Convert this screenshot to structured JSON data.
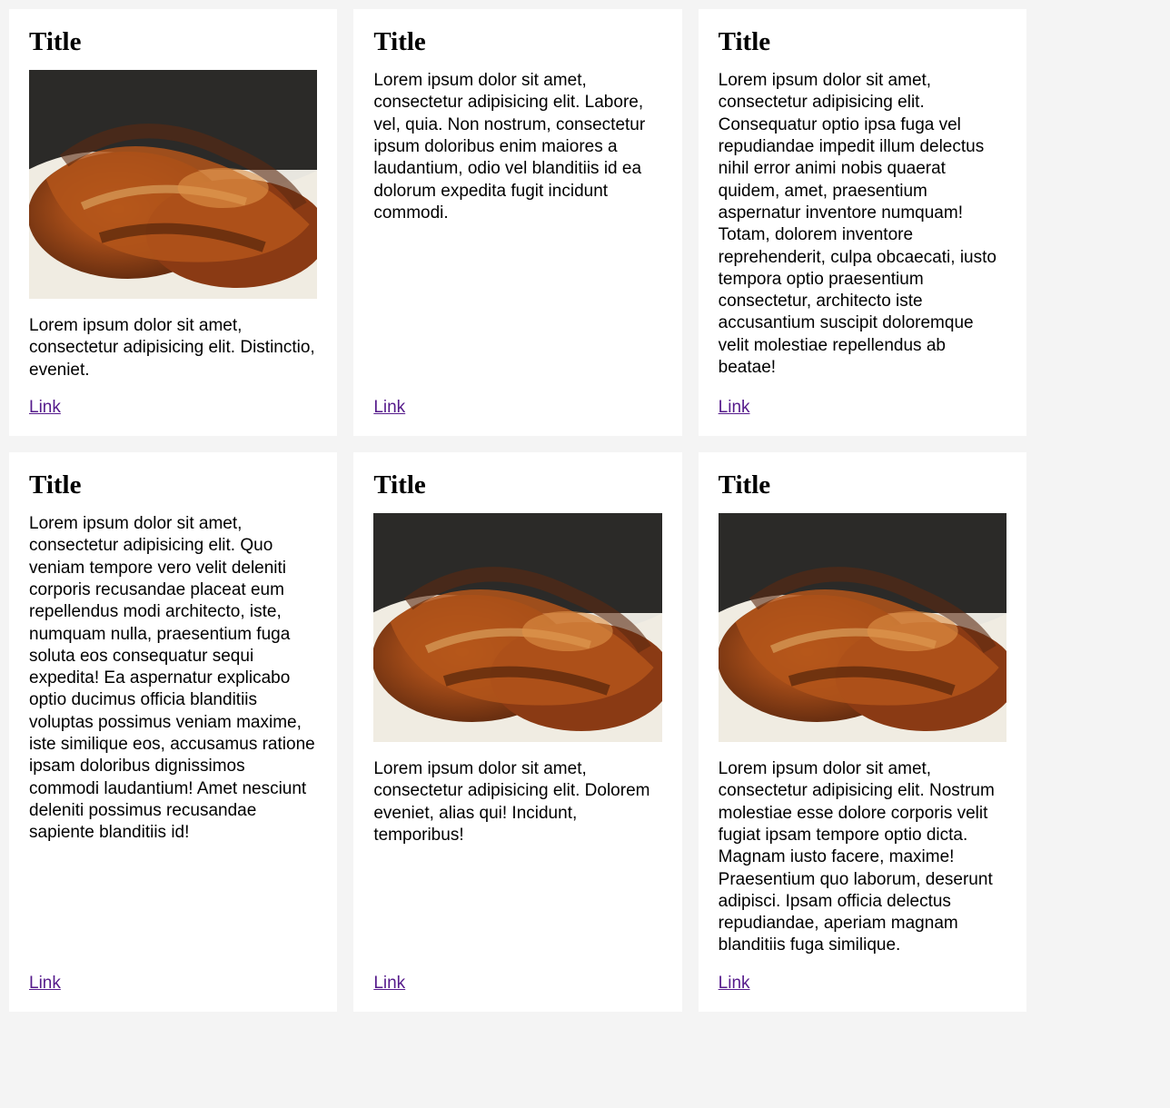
{
  "cards": [
    {
      "title": "Title",
      "hasImage": true,
      "text": "Lorem ipsum dolor sit amet, consectetur adipisicing elit. Distinctio, eveniet.",
      "linkLabel": "Link"
    },
    {
      "title": "Title",
      "hasImage": false,
      "text": "Lorem ipsum dolor sit amet, consectetur adipisicing elit. Labore, vel, quia. Non nostrum, consectetur ipsum doloribus enim maiores a laudantium, odio vel blanditiis id ea dolorum expedita fugit incidunt commodi.",
      "linkLabel": "Link"
    },
    {
      "title": "Title",
      "hasImage": false,
      "text": "Lorem ipsum dolor sit amet, consectetur adipisicing elit. Consequatur optio ipsa fuga vel repudiandae impedit illum delectus nihil error animi nobis quaerat quidem, amet, praesentium aspernatur inventore numquam! Totam, dolorem inventore reprehenderit, culpa obcaecati, iusto tempora optio praesentium consectetur, architecto iste accusantium suscipit doloremque velit molestiae repellendus ab beatae!",
      "linkLabel": "Link"
    },
    {
      "title": "Title",
      "hasImage": false,
      "text": "Lorem ipsum dolor sit amet, consectetur adipisicing elit. Quo veniam tempore vero velit deleniti corporis recusandae placeat eum repellendus modi architecto, iste, numquam nulla, praesentium fuga soluta eos consequatur sequi expedita! Ea aspernatur explicabo optio ducimus officia blanditiis voluptas possimus veniam maxime, iste similique eos, accusamus ratione ipsam doloribus dignissimos commodi laudantium! Amet nesciunt deleniti possimus recusandae sapiente blanditiis id!",
      "linkLabel": "Link"
    },
    {
      "title": "Title",
      "hasImage": true,
      "text": "Lorem ipsum dolor sit amet, consectetur adipisicing elit. Dolorem eveniet, alias qui! Incidunt, temporibus!",
      "linkLabel": "Link"
    },
    {
      "title": "Title",
      "hasImage": true,
      "text": "Lorem ipsum dolor sit amet, consectetur adipisicing elit. Nostrum molestiae esse dolore corporis velit fugiat ipsam tempore optio dicta. Magnam iusto facere, maxime! Praesentium quo laborum, deserunt adipisci. Ipsam officia delectus repudiandae, aperiam magnam blanditiis fuga similique.",
      "linkLabel": "Link"
    }
  ]
}
